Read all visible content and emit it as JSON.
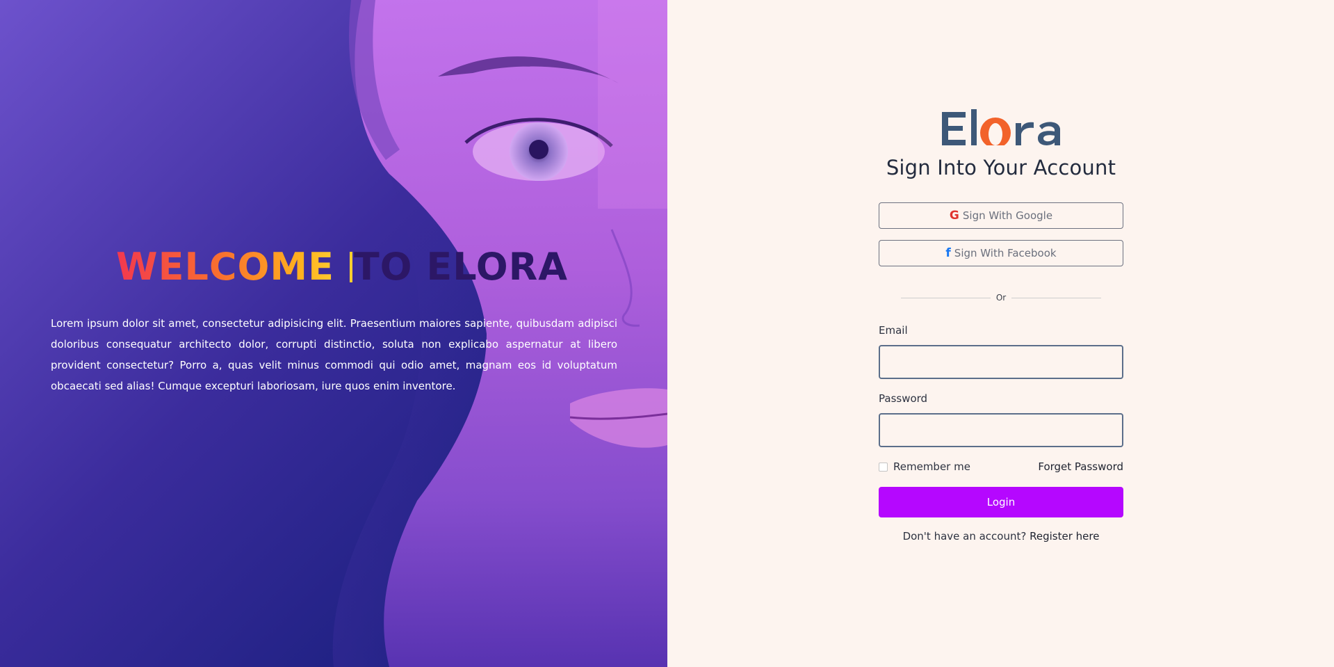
{
  "hero": {
    "title_gradient_part": "WELCOME ",
    "title_highlight_part": "T",
    "title_dark_part": "O ELORA",
    "description": "Lorem ipsum dolor sit amet, consectetur adipisicing elit. Praesentium maiores sapiente, quibusdam adipisci doloribus consequatur architecto dolor, corrupti distinctio, soluta non explicabo aspernatur at libero provident consectetur? Porro a, quas velit minus commodi qui odio amet, magnam eos id voluptatum obcaecati sed alias! Cumque excepturi laboriosam, iure quos enim inventore.",
    "image": "woman-face-portrait"
  },
  "logo": {
    "text": "Elora",
    "colors": {
      "primary": "#3d5878",
      "accent": "#f2622a"
    }
  },
  "form": {
    "title": "Sign Into Your Account",
    "google_label": "Sign With Google",
    "google_icon": "google-icon",
    "facebook_label": "Sign With Facebook",
    "facebook_icon": "facebook-icon",
    "divider_text": "Or",
    "email_label": "Email",
    "email_value": "",
    "password_label": "Password",
    "password_value": "",
    "remember_label": "Remember me",
    "remember_checked": false,
    "forget_label": "Forget Password",
    "login_label": "Login",
    "register_prompt": "Don't have an account? ",
    "register_link": "Register here"
  },
  "colors": {
    "panel_bg": "#fdf4ef",
    "login_button": "#b507ff",
    "hero_gradient_start": "#6a4fc8",
    "hero_gradient_end": "#0b1870"
  }
}
